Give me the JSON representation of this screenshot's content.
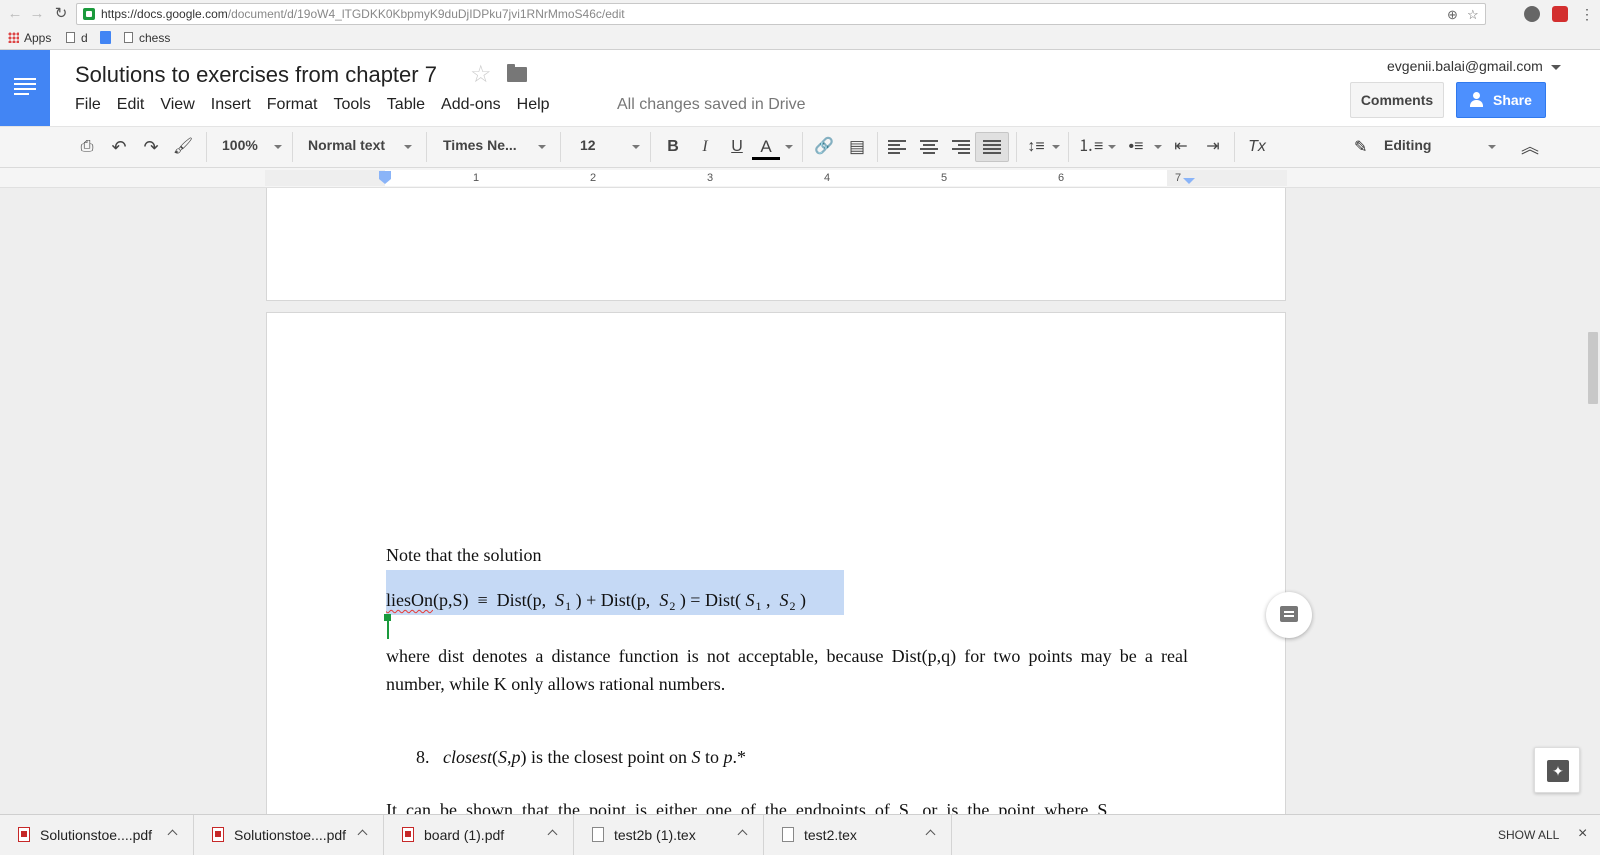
{
  "browser": {
    "url_host": "https://docs.google.com",
    "url_path": "/document/d/19oW4_lTGDKK0KbpmyK9duDjIDPku7jvi1RNrMmoS46c/edit",
    "bookmarks": {
      "apps": "Apps",
      "d": "d",
      "chess": "chess"
    }
  },
  "docs": {
    "title": "Solutions to exercises from chapter 7",
    "menu": [
      "File",
      "Edit",
      "View",
      "Insert",
      "Format",
      "Tools",
      "Table",
      "Add-ons",
      "Help"
    ],
    "save_status": "All changes saved in Drive",
    "account_email": "evgenii.balai@gmail.com",
    "comments_label": "Comments",
    "share_label": "Share"
  },
  "toolbar": {
    "zoom": "100%",
    "style": "Normal text",
    "font": "Times Ne...",
    "font_size": "12",
    "bold": "B",
    "italic": "I",
    "underline": "U",
    "text_color": "A",
    "clear_format": "Tx",
    "mode": "Editing"
  },
  "ruler": {
    "numbers": [
      "1",
      "2",
      "3",
      "4",
      "5",
      "6",
      "7"
    ]
  },
  "document": {
    "note_line": "Note that the solution",
    "formula": {
      "lies_on": "liesOn",
      "args": "(p,S)",
      "equiv": "≡",
      "dist1": "Dist(p,",
      "s": "S",
      "sub1": "1",
      "plus": ") + Dist(p,",
      "sub2": "2",
      "eq": ") = Dist(",
      "comma": ",",
      "close": ")"
    },
    "para_where": "where dist denotes a distance function is not acceptable, because Dist(p,q) for two points may be a real number, while  K only allows rational numbers.",
    "item8": {
      "number": "8.",
      "func": "closest",
      "args_open": "(",
      "args_s": "S",
      "args_comma": ",",
      "args_p": "p",
      "args_close": ")",
      "text": " is the closest point on ",
      "s": "S",
      "to": " to ",
      "p": "p",
      "tail": ".*"
    },
    "cut_line": "It  can  be  shown  that  the  point  is  either  one  of  the  endpoints  of  S,  or  is  the  point  where  S"
  },
  "downloads": {
    "items": [
      "Solutionstoe....pdf",
      "Solutionstoe....pdf",
      "board (1).pdf",
      "test2b (1).tex",
      "test2.tex"
    ],
    "show_all": "SHOW ALL",
    "close": "×"
  },
  "colors": {
    "docs_blue": "#4285f4",
    "share_blue": "#4d90fe",
    "selection": "#c5d9f5",
    "cursor_green": "#1a9a3c"
  }
}
